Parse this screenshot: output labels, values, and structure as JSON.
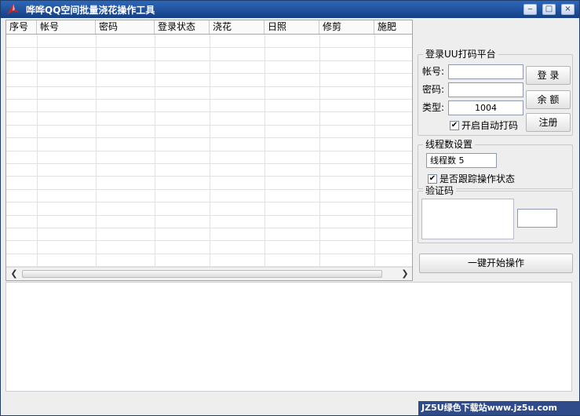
{
  "window": {
    "title": "哗哗QQ空间批量浇花操作工具",
    "controls": {
      "minimize": "‒",
      "maximize": "□",
      "close": "×"
    }
  },
  "table": {
    "columns": [
      "序号",
      "帐号",
      "密码",
      "登录状态",
      "浇花",
      "日照",
      "修剪",
      "施肥"
    ],
    "rows": []
  },
  "login_group": {
    "title": "登录UU打码平台",
    "account_label": "帐号:",
    "account_value": "",
    "password_label": "密码:",
    "password_value": "",
    "type_label": "类型:",
    "type_value": "1004",
    "login_button": "登 录",
    "balance_button": "余 额",
    "register_button": "注册",
    "auto_captcha_label": "开启自动打码",
    "auto_captcha_checked": true
  },
  "thread_group": {
    "title": "线程数设置",
    "thread_value": "线程数 5",
    "track_label": "是否跟踪操作状态",
    "track_checked": true
  },
  "captcha_group": {
    "title": "验证码",
    "input_value": ""
  },
  "start_button": "一键开始操作",
  "log_text": "",
  "watermark": "JZ5U绿色下载站www.jz5u.com",
  "icons": {
    "app": "red-arrow-icon",
    "check": "✔"
  }
}
